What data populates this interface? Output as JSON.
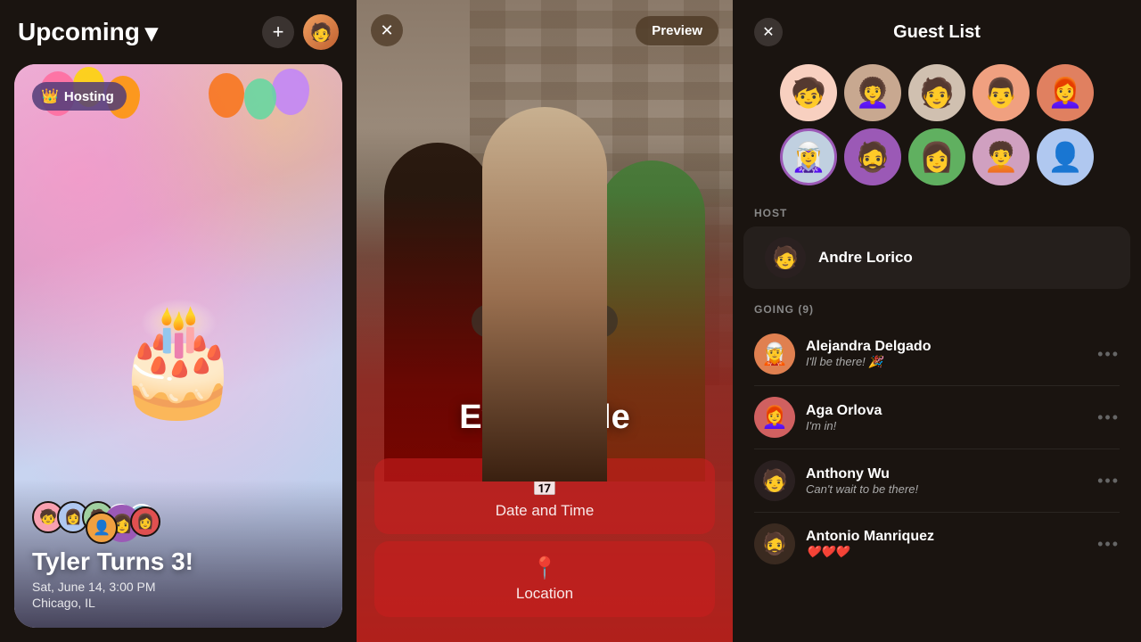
{
  "left": {
    "title": "Upcoming",
    "add_label": "+",
    "hosting_badge": "Hosting",
    "event": {
      "name": "Tyler Turns 3!",
      "date": "Sat, June 14, 3:00 PM",
      "location": "Chicago, IL"
    }
  },
  "middle": {
    "close_label": "✕",
    "preview_label": "Preview",
    "edit_bg_label": "Edit Background",
    "event_title": "Event Title",
    "datetime_label": "Date and Time",
    "location_label": "Location"
  },
  "right": {
    "title": "Guest List",
    "close_label": "✕",
    "host_section": "HOST",
    "host_name": "Andre Lorico",
    "going_section": "GOING (9)",
    "guests": [
      {
        "name": "Alejandra Delgado",
        "status": "I'll be there! 🎉",
        "emoji": "🧝"
      },
      {
        "name": "Aga Orlova",
        "status": "I'm in!",
        "emoji": "👩‍🦰"
      },
      {
        "name": "Anthony Wu",
        "status": "Can't wait to be there!",
        "emoji": "🧑"
      },
      {
        "name": "Antonio Manriquez",
        "status": "❤️❤️❤️",
        "emoji": "🧔"
      }
    ]
  },
  "icons": {
    "crown": "👑",
    "calendar": "📅",
    "location_pin": "📍",
    "more_dots": "•••"
  },
  "colors": {
    "bg": "#1a1410",
    "card_bg": "#2a2020",
    "accent_red": "#c8001a",
    "highlight_purple": "#9b59b6"
  }
}
